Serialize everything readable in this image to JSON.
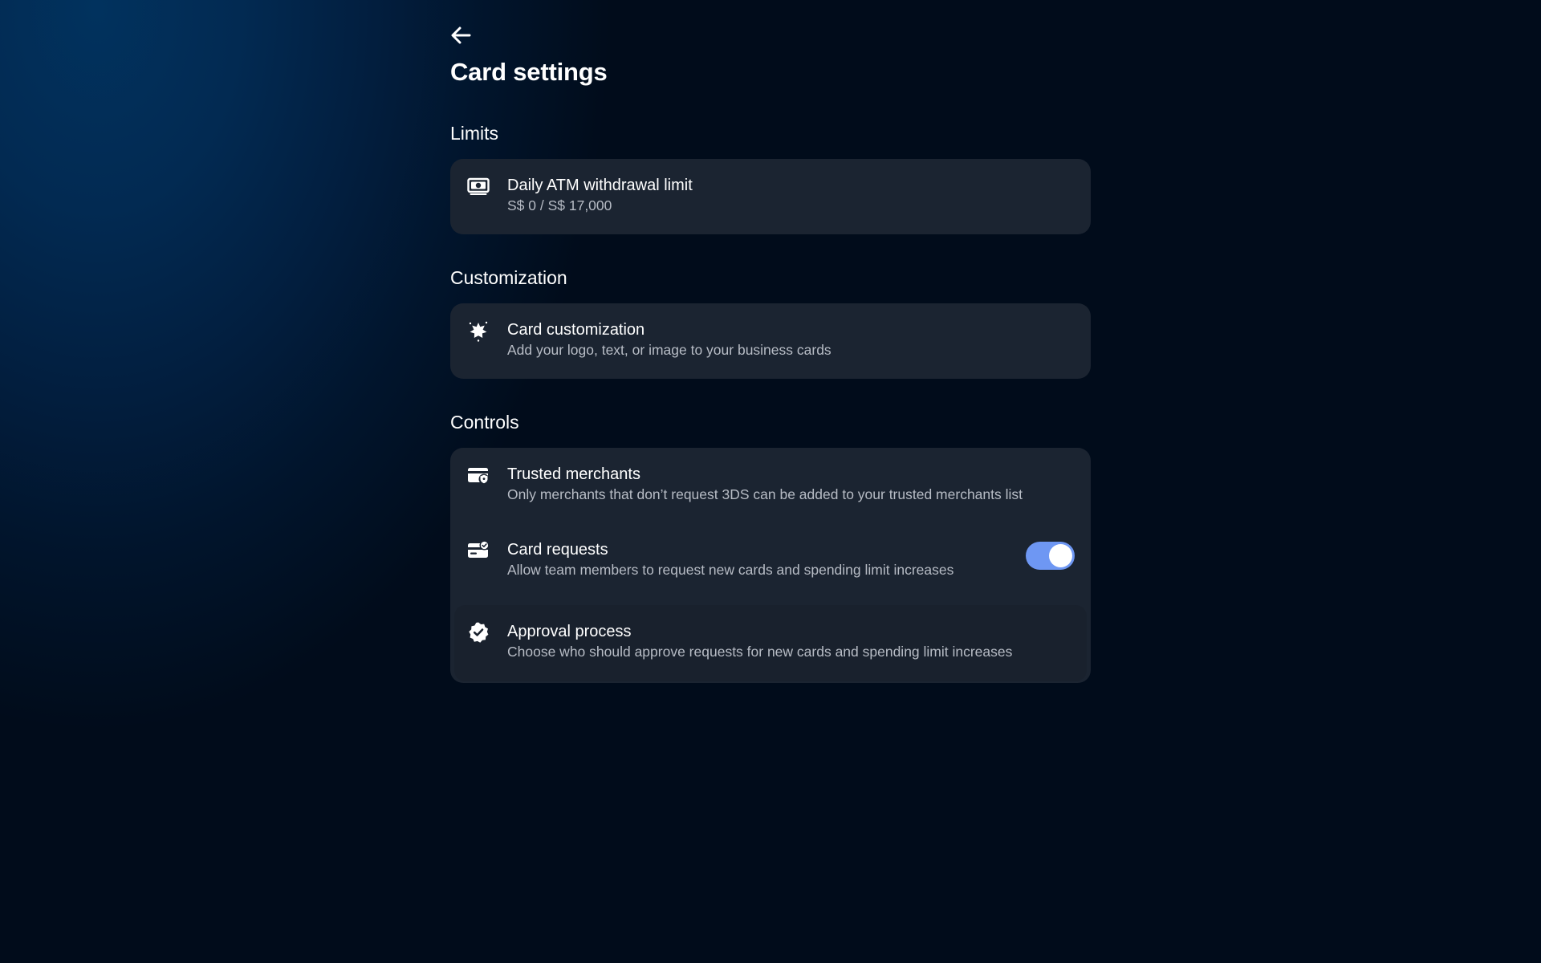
{
  "header": {
    "back_icon": "arrow-left-icon",
    "title": "Card settings"
  },
  "sections": {
    "limits": {
      "title": "Limits",
      "items": [
        {
          "icon": "banknote-icon",
          "label": "Daily ATM withdrawal limit",
          "description": "S$ 0 / S$ 17,000"
        }
      ]
    },
    "customization": {
      "title": "Customization",
      "items": [
        {
          "icon": "sparkle-icon",
          "label": "Card customization",
          "description": "Add your logo, text, or image to your business cards"
        }
      ]
    },
    "controls": {
      "title": "Controls",
      "items": [
        {
          "icon": "card-shield-icon",
          "label": "Trusted merchants",
          "description": "Only merchants that don’t request 3DS can be added to your trusted merchants list"
        },
        {
          "icon": "card-check-icon",
          "label": "Card requests",
          "description": "Allow team members to request new cards and spending limit increases",
          "toggle": true
        },
        {
          "icon": "verified-badge-icon",
          "label": "Approval process",
          "description": "Choose who should approve requests for new cards and spending limit increases"
        }
      ]
    }
  },
  "colors": {
    "background": "#010c1b",
    "card": "#1b2431",
    "toggle_on": "#6e97f3",
    "secondary_text": "#b7bcc5"
  }
}
